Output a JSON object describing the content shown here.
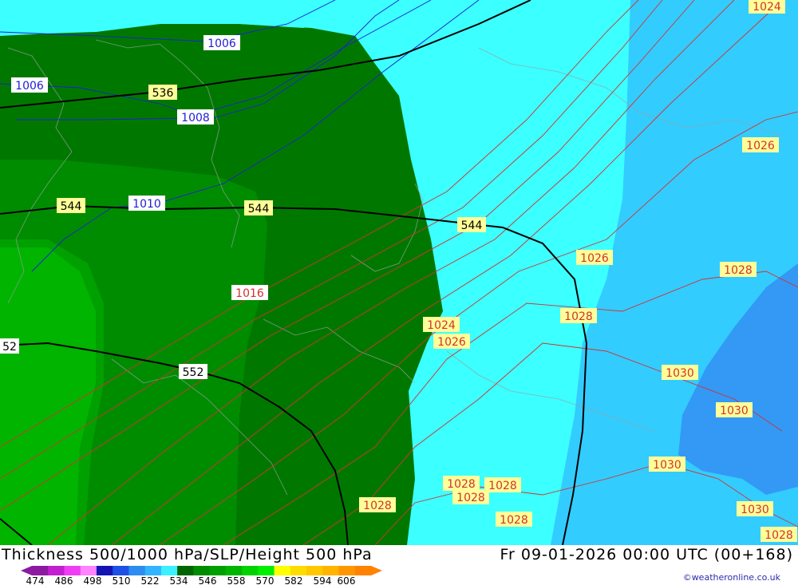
{
  "header": {
    "title": "Thickness 500/1000 hPa/SLP/Height 500 hPa",
    "valid_time": "Fr 09-01-2026 00:00 UTC (00+168)"
  },
  "credit": "©weatheronline.co.uk",
  "legend": {
    "ticks": [
      "474",
      "486",
      "498",
      "510",
      "522",
      "534",
      "546",
      "558",
      "570",
      "582",
      "594",
      "606"
    ],
    "colors": [
      "#8c1aa0",
      "#c21fd1",
      "#f03cf5",
      "#ff82ff",
      "#1414b4",
      "#1e50e6",
      "#2d8cf0",
      "#32b4ff",
      "#3cf0ff",
      "#006400",
      "#008c00",
      "#00a000",
      "#00b400",
      "#00d200",
      "#00f000",
      "#ffff00",
      "#ffdc00",
      "#ffc800",
      "#ffb400",
      "#ff9600",
      "#ff8200"
    ]
  },
  "map": {
    "colors": {
      "thick_536": "#007800",
      "thick_540": "#008c00",
      "thick_546": "#00a000",
      "thick_552": "#00b400",
      "thick_528": "#3cffff",
      "thick_522": "#30d0ff",
      "thick_516": "#3296f5",
      "slp_low": "#2020d0",
      "slp_high": "#d23232",
      "height": "#000000"
    },
    "height_labels": [
      "536",
      "544",
      "544",
      "544",
      "552",
      "52"
    ],
    "slp_blue_labels": [
      "1006",
      "1006",
      "1008",
      "1010"
    ],
    "slp_red_labels": [
      "1016",
      "1024",
      "1026",
      "1026",
      "1026",
      "1028",
      "1028",
      "1028",
      "1028",
      "1028",
      "1028",
      "1028",
      "1030",
      "1030",
      "1030",
      "1030",
      "1024",
      "1028"
    ]
  }
}
